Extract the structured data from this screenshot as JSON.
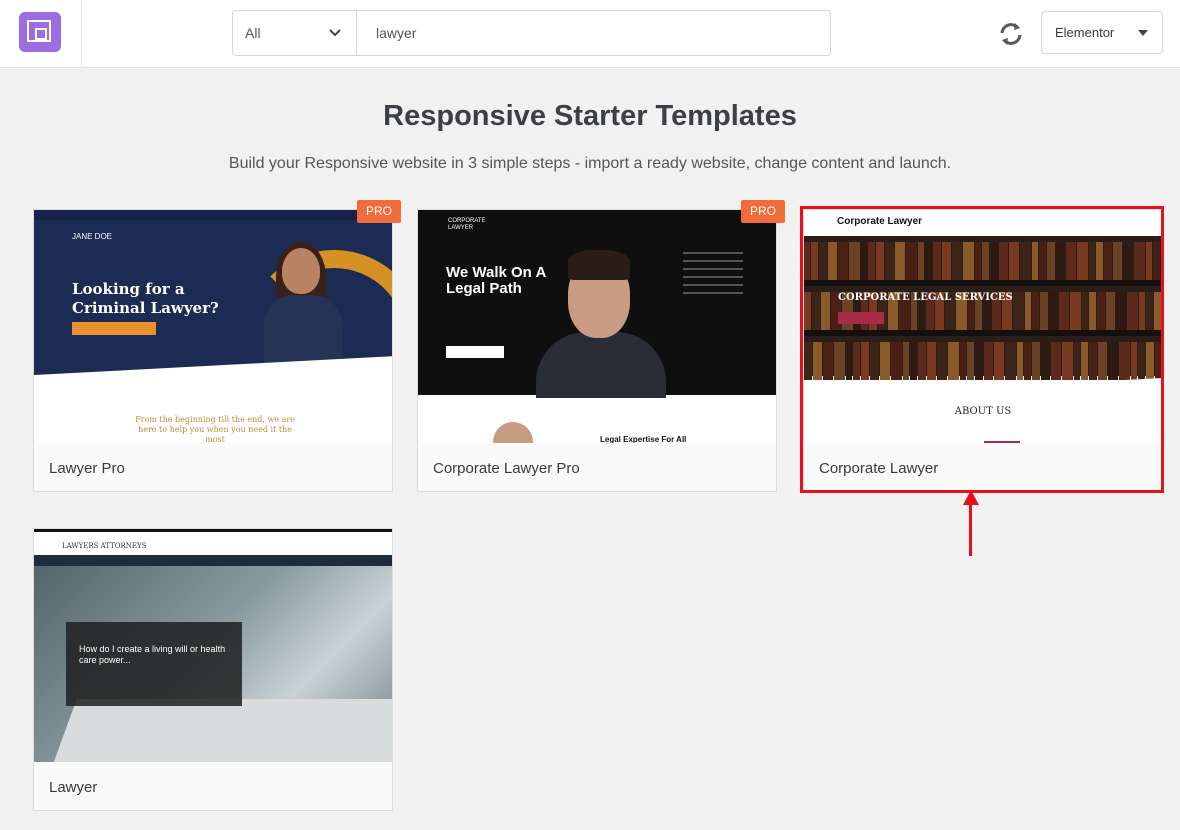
{
  "header": {
    "filter_value": "All",
    "search_value": "lawyer",
    "builder_value": "Elementor"
  },
  "main": {
    "title": "Responsive Starter Templates",
    "subtitle": "Build your Responsive website in 3 simple steps - import a ready website, change content and launch."
  },
  "templates": [
    {
      "name": "Lawyer Pro",
      "pro": true,
      "badge": "PRO",
      "preview": {
        "brand": "JANE DOE",
        "headline": "Looking for a Criminal Lawyer?",
        "body": "From the beginning till the end, we are here to help you when you need it the most"
      }
    },
    {
      "name": "Corporate Lawyer Pro",
      "pro": true,
      "badge": "PRO",
      "preview": {
        "brand": "CORPORATE LAWYER",
        "headline": "We Walk On A Legal Path",
        "section": "Legal Expertise For All"
      }
    },
    {
      "name": "Corporate Lawyer",
      "pro": false,
      "highlighted": true,
      "preview": {
        "brand": "Corporate Lawyer",
        "headline": "CORPORATE LEGAL SERVICES",
        "section": "ABOUT US"
      }
    },
    {
      "name": "Lawyer",
      "pro": false,
      "preview": {
        "brand": "LAWYERS ATTORNEYS",
        "headline": "How do I create a living will or health care power..."
      }
    }
  ],
  "colors": {
    "brand": "#9c6ce0",
    "pro_badge": "#f26b3a",
    "highlight": "#e5121b"
  }
}
